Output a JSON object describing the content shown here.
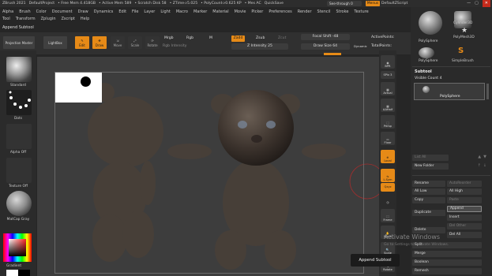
{
  "titlebar": {
    "items": [
      "ZBrush 2021",
      "DefaultProject",
      "• Free Mem 4.418GB",
      "• Active Mem 589",
      "• Scratch Disk 58",
      "• ZTime➩5.025",
      "• PolyCount➩0.625 KP",
      "• Mes AC",
      "QuickSave"
    ],
    "see_through": "See-through  0",
    "menus": "Menus",
    "default_script": "DefaultZScript",
    "min": "—",
    "max": "▢",
    "close": "✕"
  },
  "menubar": {
    "row1": [
      "Alpha",
      "Brush",
      "Color",
      "Document",
      "Draw",
      "Dynamics",
      "Edit",
      "File",
      "Layer",
      "Light",
      "Macro",
      "Marker",
      "Material",
      "Movie",
      "Picker",
      "Preferences",
      "Render",
      "Stencil",
      "Stroke",
      "Texture"
    ],
    "row2": [
      "Tool",
      "Transform",
      "Zplugin",
      "Zscript",
      "Help"
    ]
  },
  "subtool_header": "Append Subtool",
  "toolbar": {
    "projection_master": "Projection Master",
    "lightbox": "LightBox",
    "edit": "Edit",
    "draw": "Draw",
    "move": "Move",
    "scale": "Scale",
    "rotate": "Rotate",
    "mrgb": "Mrgb",
    "rgb": "Rgb",
    "m": "M",
    "rgb_intensity": "Rgb Intensity",
    "zadd": "Zadd",
    "zsub": "Zsub",
    "zcut": "Zcut",
    "z_intensity": "Z Intensity 25",
    "focal_shift": "Focal Shift -48",
    "draw_size": "Draw Size 64",
    "dynamic": "Dynamic",
    "active_points": "ActivePoints:",
    "total_points": "TotalPoints:"
  },
  "leftshelf": {
    "brush_label": "Standard",
    "stroke_label": "Dots",
    "alpha_label": "Alpha Off",
    "texture_label": "Texture Off",
    "material_label": "MatCap Gray",
    "gradient_label": "Gradient"
  },
  "rightshelf": {
    "buttons": [
      "BPR",
      "SPix 3",
      "Actual",
      "AAHalf",
      "Persp",
      "Floor",
      "Local",
      "L.Sym",
      "Qxyz",
      "",
      "Frame",
      "Move",
      "Scale",
      "Rotate"
    ]
  },
  "rpanel": {
    "tools": [
      {
        "label": "PolySphere"
      },
      {
        "label": "Cylinder3D"
      },
      {
        "label": "PolyMesh3D"
      },
      {
        "label": "PolySphere"
      },
      {
        "label": "SimpleBrush"
      }
    ],
    "subtool_title": "Subtool",
    "visible_count": "Visible Count 4",
    "subtool_item": "PolySphere",
    "list_all": "List All",
    "new_folder": "New Folder",
    "rename": "Rename",
    "autoreorder": "AutoReorder",
    "all_low": "All Low",
    "all_high": "All High",
    "copy": "Copy",
    "paste": "Paste",
    "duplicate": "Duplicate",
    "append": "Append",
    "insert": "Insert",
    "delete": "Delete",
    "del_other": "Del Other",
    "del_all": "Del All",
    "split": "Split",
    "merge": "Merge",
    "boolean": "Boolean",
    "remesh": "Remesh"
  },
  "tooltip": "Append Subtool",
  "watermark": {
    "title": "Activate Windows",
    "sub": "Go to Settings to activate Windows."
  },
  "colors": {
    "accent": "#e68a17",
    "canvas": "#3d3d3d",
    "panel": "#2a2a2a"
  }
}
